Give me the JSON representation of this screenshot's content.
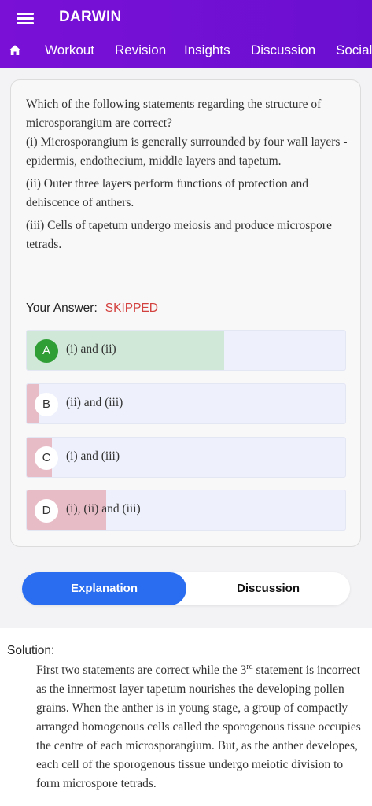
{
  "app": {
    "title": "DARWIN"
  },
  "nav": {
    "items": [
      {
        "label": "Workout"
      },
      {
        "label": "Revision"
      },
      {
        "label": "Insights"
      },
      {
        "label": "Discussion"
      },
      {
        "label": "Social"
      }
    ]
  },
  "question": {
    "stem": "Which of the following statements regarding the structure of microsporangium are correct?",
    "s1": "(i) Microsporangium is generally surrounded by four wall layers - epidermis, endothecium, middle layers and tapetum.",
    "s2": "(ii) Outer three layers perform functions of protection and dehiscence of anthers.",
    "s3": "(iii) Cells of tapetum undergo meiosis and produce microspore tetrads."
  },
  "answer": {
    "label": "Your Answer:",
    "value": "SKIPPED"
  },
  "options": [
    {
      "letter": "A",
      "text": "(i) and (ii)",
      "correct": true,
      "share": 0.62
    },
    {
      "letter": "B",
      "text": "(ii) and (iii)",
      "correct": false,
      "share": 0.04
    },
    {
      "letter": "C",
      "text": "(i) and (iii)",
      "correct": false,
      "share": 0.08
    },
    {
      "letter": "D",
      "text": "(i), (ii) and (iii)",
      "correct": false,
      "share": 0.25
    }
  ],
  "colors": {
    "correct_fill": "#cfe8d7",
    "wrong_fill": "#e8bcc6",
    "accent": "#2a6df0",
    "header": "#7a10d6"
  },
  "tabs": {
    "explanation": "Explanation",
    "discussion": "Discussion"
  },
  "solution": {
    "label": "Solution:",
    "text_a": "First two statements are correct while the 3",
    "sup": "rd",
    "text_b": " statement is incorrect as the innermost layer tapetum nourishes the developing pollen grains. When the anther is in young stage, a group of compactly arranged homogenous cells called the sporogenous tissue occupies the centre of each microsporangium. But, as the anther developes, each cell of the sporogenous tissue undergo meiotic division to form microspore tetrads."
  }
}
